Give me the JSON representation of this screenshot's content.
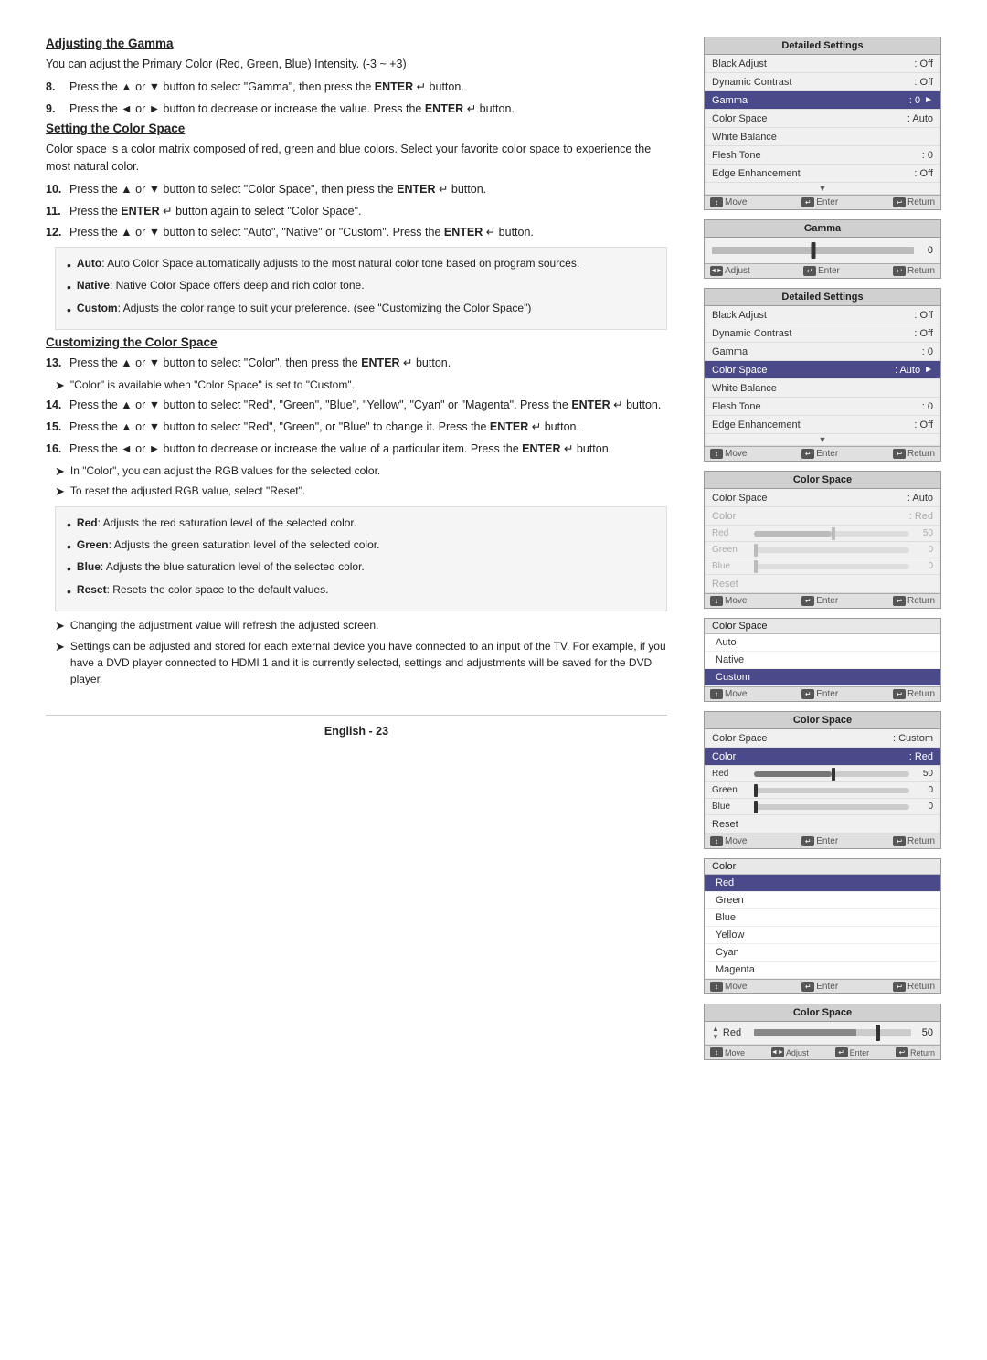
{
  "sections": {
    "gamma": {
      "heading": "Adjusting the Gamma",
      "body": "You can adjust the Primary Color (Red, Green, Blue) Intensity. (-3 ~ +3)",
      "items": [
        {
          "num": "8.",
          "text": "Press the ▲ or ▼ button to select \"Gamma\", then press the ENTER ↵ button."
        },
        {
          "num": "9.",
          "text": "Press the ◄ or ► button to decrease or increase the value. Press the ENTER ↵ button."
        }
      ]
    },
    "colorspace": {
      "heading": "Setting the Color Space",
      "body": "Color space is a color matrix composed of red, green and blue colors. Select your favorite color space to experience the most natural color.",
      "items": [
        {
          "num": "10.",
          "text": "Press the ▲ or ▼ button to select \"Color Space\", then press the ENTER ↵ button."
        },
        {
          "num": "11.",
          "text": "Press the ENTER ↵ button again to select \"Color Space\"."
        },
        {
          "num": "12.",
          "text": "Press the ▲ or ▼ button to select \"Auto\", \"Native\" or \"Custom\". Press the ENTER ↵ button."
        }
      ],
      "bullets": [
        {
          "bold": "Auto",
          "rest": ": Auto Color Space automatically adjusts to the most natural color tone based on program sources."
        },
        {
          "bold": "Native",
          "rest": ": Native Color Space offers deep and rich color tone."
        },
        {
          "bold": "Custom",
          "rest": ": Adjusts the color range to suit your preference. (see \"Customizing the Color Space\")"
        }
      ]
    },
    "customize": {
      "heading": "Customizing the Color Space",
      "items": [
        {
          "num": "13.",
          "text": "Press the ▲ or ▼ button to select \"Color\", then press the ENTER ↵ button."
        },
        {
          "num": "14.",
          "text": "Press the ▲ or ▼ button to select \"Red\", \"Green\", \"Blue\", \"Yellow\", \"Cyan\" or \"Magenta\". Press the ENTER ↵ button."
        },
        {
          "num": "15.",
          "text": "Press the ▲ or ▼ button to select \"Red\", \"Green\", or \"Blue\" to change it. Press the ENTER ↵ button."
        },
        {
          "num": "16.",
          "text": "Press the ◄ or ► button to decrease or increase the value of a particular item. Press the ENTER ↵ button."
        }
      ],
      "arrows": [
        "In \"Color\", you can adjust the RGB values for the selected color.",
        "To reset the adjusted RGB value, select \"Reset\"."
      ],
      "bullets2": [
        {
          "bold": "Red",
          "rest": ": Adjusts the red saturation level of the selected color."
        },
        {
          "bold": "Green",
          "rest": ": Adjusts the green saturation level of the selected color."
        },
        {
          "bold": "Blue",
          "rest": ": Adjusts the blue saturation level of the selected color."
        },
        {
          "bold": "Reset",
          "rest": ": Resets the color space to the default values."
        }
      ],
      "arrows2": [
        "Changing the adjustment value will refresh the adjusted screen.",
        "Settings can be adjusted and stored for each external device you have connected to an input of the TV. For example, if you have a DVD player connected to HDMI 1 and it is currently selected, settings and adjustments will be saved for the DVD player."
      ]
    }
  },
  "footer": {
    "text": "English - 23"
  },
  "panels": {
    "detailedSettings1": {
      "title": "Detailed Settings",
      "rows": [
        {
          "label": "Black Adjust",
          "value": ": Off",
          "highlighted": false
        },
        {
          "label": "Dynamic Contrast",
          "value": ": Off",
          "highlighted": false
        },
        {
          "label": "Gamma",
          "value": ": 0",
          "highlighted": true,
          "arrow": "►"
        },
        {
          "label": "Color Space",
          "value": ": Auto",
          "highlighted": false
        },
        {
          "label": "White Balance",
          "value": "",
          "highlighted": false
        },
        {
          "label": "Flesh Tone",
          "value": ": 0",
          "highlighted": false
        },
        {
          "label": "Edge Enhancement",
          "value": ": Off",
          "highlighted": false
        }
      ],
      "footer": [
        {
          "icon": "↕",
          "label": "Move"
        },
        {
          "icon": "↵",
          "label": "Enter"
        },
        {
          "icon": "↩",
          "label": "Return"
        }
      ]
    },
    "gamma": {
      "title": "Gamma",
      "value": "0",
      "footer": [
        {
          "icon": "◄►",
          "label": "Adjust"
        },
        {
          "icon": "↵",
          "label": "Enter"
        },
        {
          "icon": "↩",
          "label": "Return"
        }
      ]
    },
    "detailedSettings2": {
      "title": "Detailed Settings",
      "rows": [
        {
          "label": "Black Adjust",
          "value": ": Off",
          "highlighted": false
        },
        {
          "label": "Dynamic Contrast",
          "value": ": Off",
          "highlighted": false
        },
        {
          "label": "Gamma",
          "value": ": 0",
          "highlighted": false
        },
        {
          "label": "Color Space",
          "value": ": Auto",
          "highlighted": true,
          "arrow": "►"
        },
        {
          "label": "White Balance",
          "value": "",
          "highlighted": false
        },
        {
          "label": "Flesh Tone",
          "value": ": 0",
          "highlighted": false
        },
        {
          "label": "Edge Enhancement",
          "value": ": Off",
          "highlighted": false
        }
      ],
      "footer": [
        {
          "icon": "↕",
          "label": "Move"
        },
        {
          "icon": "↵",
          "label": "Enter"
        },
        {
          "icon": "↩",
          "label": "Return"
        }
      ]
    },
    "colorSpace1": {
      "title": "Color Space",
      "rows": [
        {
          "label": "Color Space",
          "value": ": Auto",
          "highlighted": false
        },
        {
          "label": "Color",
          "value": ": Red",
          "highlighted": false,
          "dim": true
        },
        {
          "label": "Red",
          "slider": true,
          "percent": 50,
          "value": "50",
          "dim": true
        },
        {
          "label": "Green",
          "slider": true,
          "percent": 0,
          "value": "0",
          "dim": true
        },
        {
          "label": "Blue",
          "slider": true,
          "percent": 0,
          "value": "0",
          "dim": true
        },
        {
          "label": "Reset",
          "value": "",
          "dim": true
        }
      ],
      "footer": [
        {
          "icon": "↕",
          "label": "Move"
        },
        {
          "icon": "↵",
          "label": "Enter"
        },
        {
          "icon": "↩",
          "label": "Return"
        }
      ]
    },
    "colorSpaceDropdown": {
      "header": {
        "label": "Color Space",
        "value": ""
      },
      "items": [
        "Auto",
        "Native",
        "Custom"
      ],
      "selectedIndex": 2,
      "footer": [
        {
          "icon": "↕",
          "label": "Move"
        },
        {
          "icon": "↵",
          "label": "Enter"
        },
        {
          "icon": "↩",
          "label": "Return"
        }
      ]
    },
    "colorSpace2": {
      "title": "Color Space",
      "rows": [
        {
          "label": "Color Space",
          "value": ": Custom",
          "highlighted": false
        },
        {
          "label": "Color",
          "value": ": Red",
          "highlighted": true
        },
        {
          "label": "Red",
          "slider": true,
          "percent": 50,
          "value": "50"
        },
        {
          "label": "Green",
          "slider": true,
          "percent": 0,
          "value": "0"
        },
        {
          "label": "Blue",
          "slider": true,
          "percent": 0,
          "value": "0"
        },
        {
          "label": "Reset",
          "value": ""
        }
      ],
      "footer": [
        {
          "icon": "↕",
          "label": "Move"
        },
        {
          "icon": "↵",
          "label": "Enter"
        },
        {
          "icon": "↩",
          "label": "Return"
        }
      ]
    },
    "colorDropdown": {
      "header": {
        "label": "Color",
        "value": ""
      },
      "items": [
        "Red",
        "Green",
        "Blue",
        "Yellow",
        "Cyan",
        "Magenta"
      ],
      "selectedIndex": 0,
      "footer": [
        {
          "icon": "↕",
          "label": "Move"
        },
        {
          "icon": "↵",
          "label": "Enter"
        },
        {
          "icon": "↩",
          "label": "Return"
        }
      ]
    },
    "colorSpaceRed": {
      "title": "Color Space",
      "redLabel": "Red",
      "redValue": "50",
      "redPercent": 65,
      "footer": [
        {
          "icon": "↕",
          "label": "Move"
        },
        {
          "icon": "◄►",
          "label": "Adjust"
        },
        {
          "icon": "↵",
          "label": "Enter"
        },
        {
          "icon": "↩",
          "label": "Return"
        }
      ]
    }
  }
}
